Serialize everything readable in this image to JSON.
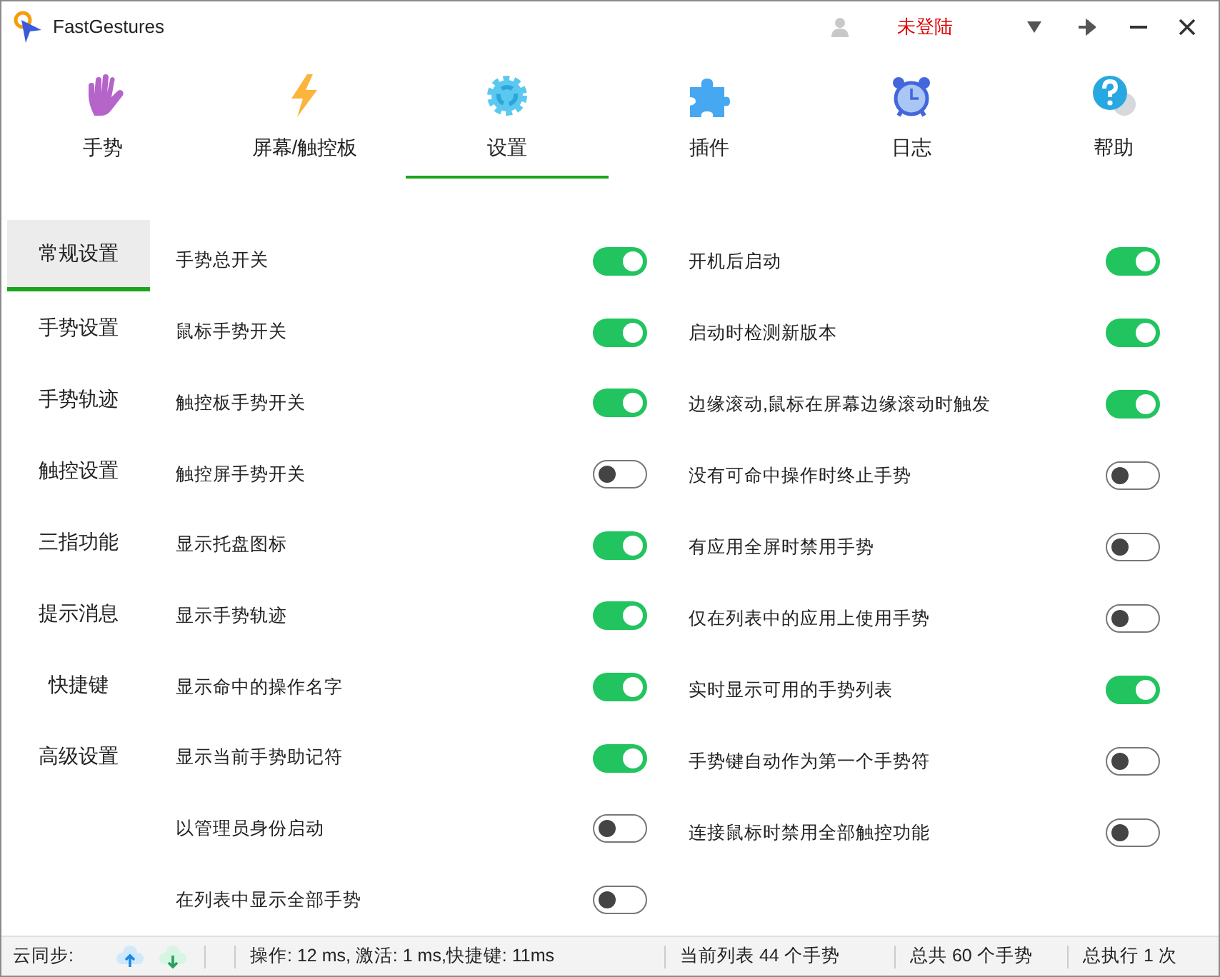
{
  "window": {
    "title": "FastGestures",
    "user": "未登陆"
  },
  "tabs": [
    {
      "label": "手势",
      "selected": false
    },
    {
      "label": "屏幕/触控板",
      "selected": false
    },
    {
      "label": "设置",
      "selected": true
    },
    {
      "label": "插件",
      "selected": false
    },
    {
      "label": "日志",
      "selected": false
    },
    {
      "label": "帮助",
      "selected": false
    }
  ],
  "sidebar": {
    "items": [
      {
        "label": "常规设置",
        "selected": true
      },
      {
        "label": "手势设置",
        "selected": false
      },
      {
        "label": "手势轨迹",
        "selected": false
      },
      {
        "label": "触控设置",
        "selected": false
      },
      {
        "label": "三指功能",
        "selected": false
      },
      {
        "label": "提示消息",
        "selected": false
      },
      {
        "label": "快捷键",
        "selected": false
      },
      {
        "label": "高级设置",
        "selected": false
      }
    ]
  },
  "settings_left": [
    {
      "label": "手势总开关",
      "on": true
    },
    {
      "label": "鼠标手势开关",
      "on": true
    },
    {
      "label": "触控板手势开关",
      "on": true
    },
    {
      "label": "触控屏手势开关",
      "on": false
    },
    {
      "label": "显示托盘图标",
      "on": true
    },
    {
      "label": "显示手势轨迹",
      "on": true
    },
    {
      "label": "显示命中的操作名字",
      "on": true
    },
    {
      "label": "显示当前手势助记符",
      "on": true
    },
    {
      "label": "以管理员身份启动",
      "on": false
    },
    {
      "label": "在列表中显示全部手势",
      "on": false
    }
  ],
  "settings_right": [
    {
      "label": "开机后启动",
      "on": true
    },
    {
      "label": "启动时检测新版本",
      "on": true
    },
    {
      "label": "边缘滚动,鼠标在屏幕边缘滚动时触发",
      "on": true
    },
    {
      "label": "没有可命中操作时终止手势",
      "on": false
    },
    {
      "label": "有应用全屏时禁用手势",
      "on": false
    },
    {
      "label": "仅在列表中的应用上使用手势",
      "on": false
    },
    {
      "label": "实时显示可用的手势列表",
      "on": true
    },
    {
      "label": "手势键自动作为第一个手势符",
      "on": false
    },
    {
      "label": "连接鼠标时禁用全部触控功能",
      "on": false
    }
  ],
  "status_bar": {
    "sync_label": "云同步:",
    "timing": "操作: 12 ms, 激活: 1 ms,快捷键: 11ms",
    "current_list": "当前列表 44 个手势",
    "total": "总共 60 个手势",
    "executed": "总执行 1 次"
  }
}
